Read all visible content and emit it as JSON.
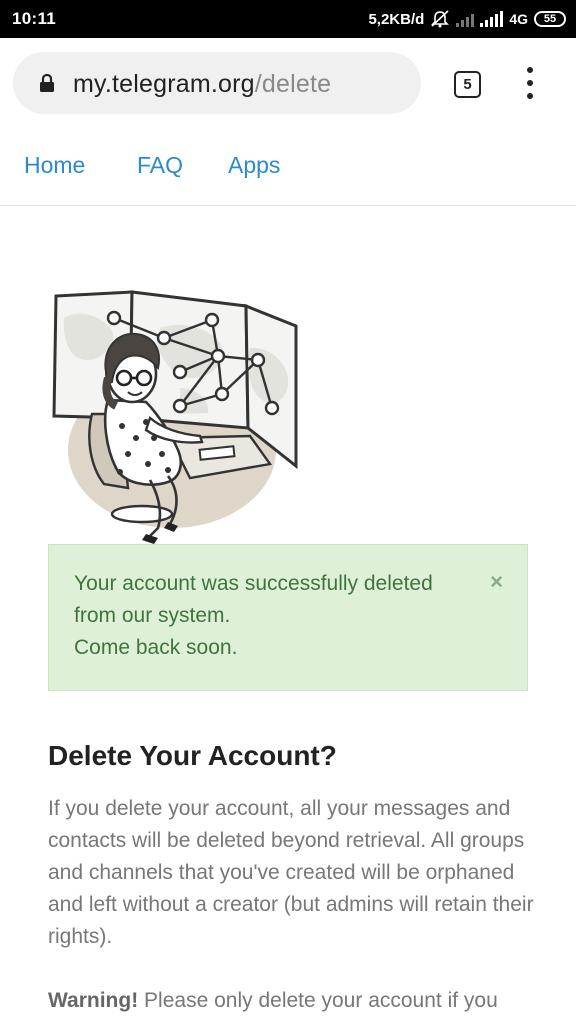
{
  "status_bar": {
    "time": "10:11",
    "speed": "5,2KB/d",
    "network": "4G",
    "battery": "55"
  },
  "browser": {
    "url_host": "my.telegram.org",
    "url_path": "/delete",
    "tab_count": "5"
  },
  "nav": {
    "home": "Home",
    "faq": "FAQ",
    "apps": "Apps"
  },
  "alert": {
    "line1": "Your account was successfully deleted",
    "line2": "from our system.",
    "line3": "Come back soon.",
    "close": "×"
  },
  "content": {
    "heading": "Delete Your Account?",
    "paragraph": "If you delete your account, all your messages and contacts will be deleted beyond retrieval. All groups and channels that you've created will be orphaned and left without a creator (but admins will retain their rights).",
    "warning_label": "Warning!",
    "warning_text": " Please only delete your account if you"
  }
}
